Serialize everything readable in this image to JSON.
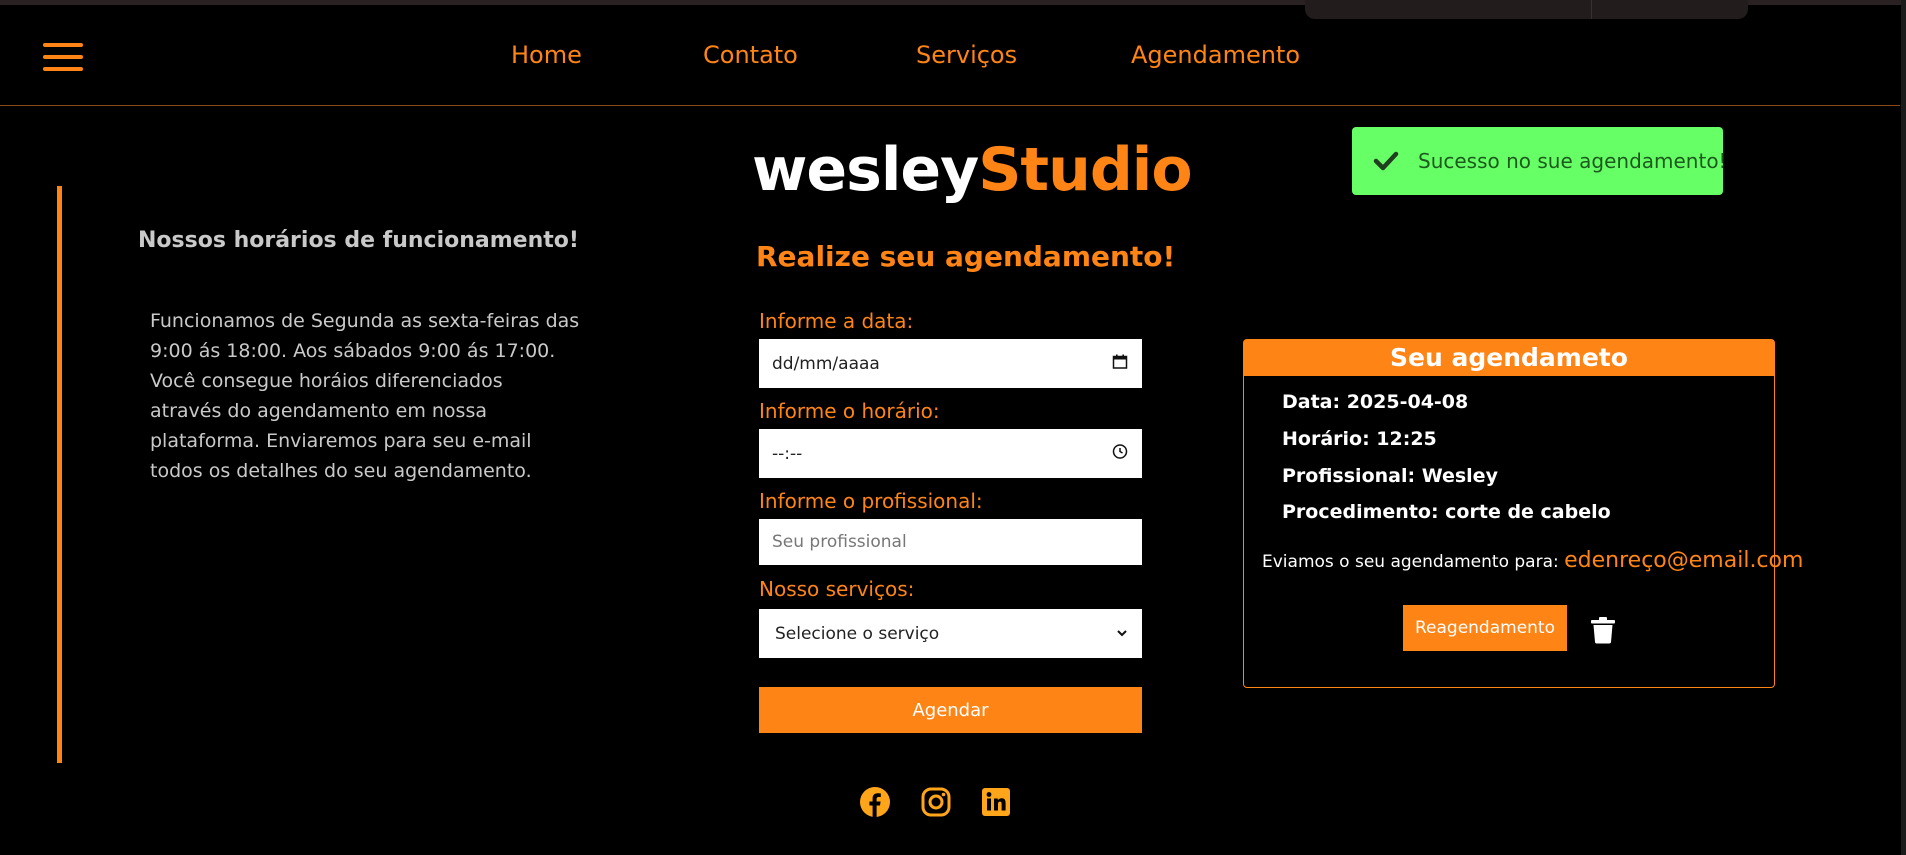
{
  "nav": {
    "items": [
      {
        "label": "Home"
      },
      {
        "label": "Contato"
      },
      {
        "label": "Serviços"
      },
      {
        "label": "Agendamento"
      }
    ]
  },
  "hours": {
    "title": "Nossos horários de funcionamento!",
    "text": "Funcionamos de Segunda as sexta-feiras das 9:00 ás 18:00. Aos sábados 9:00 ás 17:00. Você consegue horáios diferenciados através do agendamento em nossa plataforma. Enviaremos para seu e-mail todos os detalhes do seu agendamento."
  },
  "logo": {
    "part1": "wesley",
    "part2": "Studio"
  },
  "form": {
    "title": "Realize seu agendamento!",
    "date_label": "Informe a data:",
    "date_value": "dd/mm/aaaa",
    "time_label": "Informe o horário:",
    "time_value": "--:--",
    "pro_label": "Informe o profissional:",
    "pro_placeholder": "Seu profissional",
    "service_label": "Nosso serviços:",
    "service_selected": "Selecione o serviço",
    "submit": "Agendar"
  },
  "toast": {
    "message": "Sucesso no sue agendamento!"
  },
  "card": {
    "title": "Seu agendameto",
    "data": "Data: 2025-04-08",
    "horario": "Horário: 12:25",
    "profissional": "Profissional: Wesley",
    "procedimento": "Procedimento: corte de cabelo",
    "sent_text": "Eviamos o seu agendamento para:",
    "email": "edenreço@email.com",
    "reschedule": "Reagendamento"
  },
  "social": [
    "facebook-icon",
    "instagram-icon",
    "linkedin-icon"
  ],
  "colors": {
    "accent": "#ff8416",
    "background": "#000000",
    "success": "#66ff66",
    "social": "#ffa51a"
  }
}
